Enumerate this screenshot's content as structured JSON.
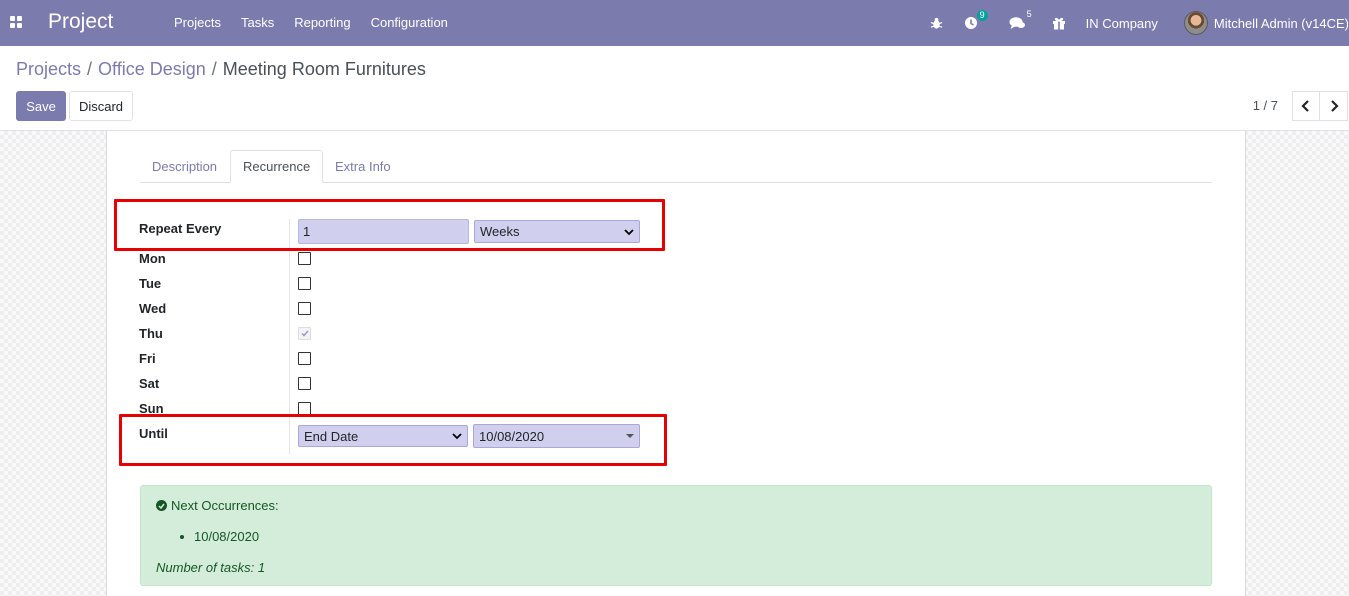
{
  "navbar": {
    "app_title": "Project",
    "menu": [
      "Projects",
      "Tasks",
      "Reporting",
      "Configuration"
    ],
    "activity_count": "9",
    "messages_count": "5",
    "company": "IN Company",
    "user": "Mitchell Admin (v14CE)",
    "color": "#7c7bad"
  },
  "breadcrumb": [
    "Projects",
    "Office Design",
    "Meeting Room Furnitures"
  ],
  "buttons": {
    "save": "Save",
    "discard": "Discard"
  },
  "pager": {
    "value": "1 / 7"
  },
  "tabs": [
    "Description",
    "Recurrence",
    "Extra Info"
  ],
  "active_tab": "Recurrence",
  "recurrence": {
    "repeat_every_label": "Repeat Every",
    "repeat_interval": "1",
    "repeat_unit": "Weeks",
    "days": [
      {
        "label": "Mon",
        "checked": false
      },
      {
        "label": "Tue",
        "checked": false
      },
      {
        "label": "Wed",
        "checked": false
      },
      {
        "label": "Thu",
        "checked": true
      },
      {
        "label": "Fri",
        "checked": false
      },
      {
        "label": "Sat",
        "checked": false
      },
      {
        "label": "Sun",
        "checked": false
      }
    ],
    "until_label": "Until",
    "until_type": "End Date",
    "until_date": "10/08/2020"
  },
  "next_occurrences": {
    "title": "Next Occurrences:",
    "dates": [
      "10/08/2020"
    ],
    "number_of_tasks": "Number of tasks: 1"
  }
}
